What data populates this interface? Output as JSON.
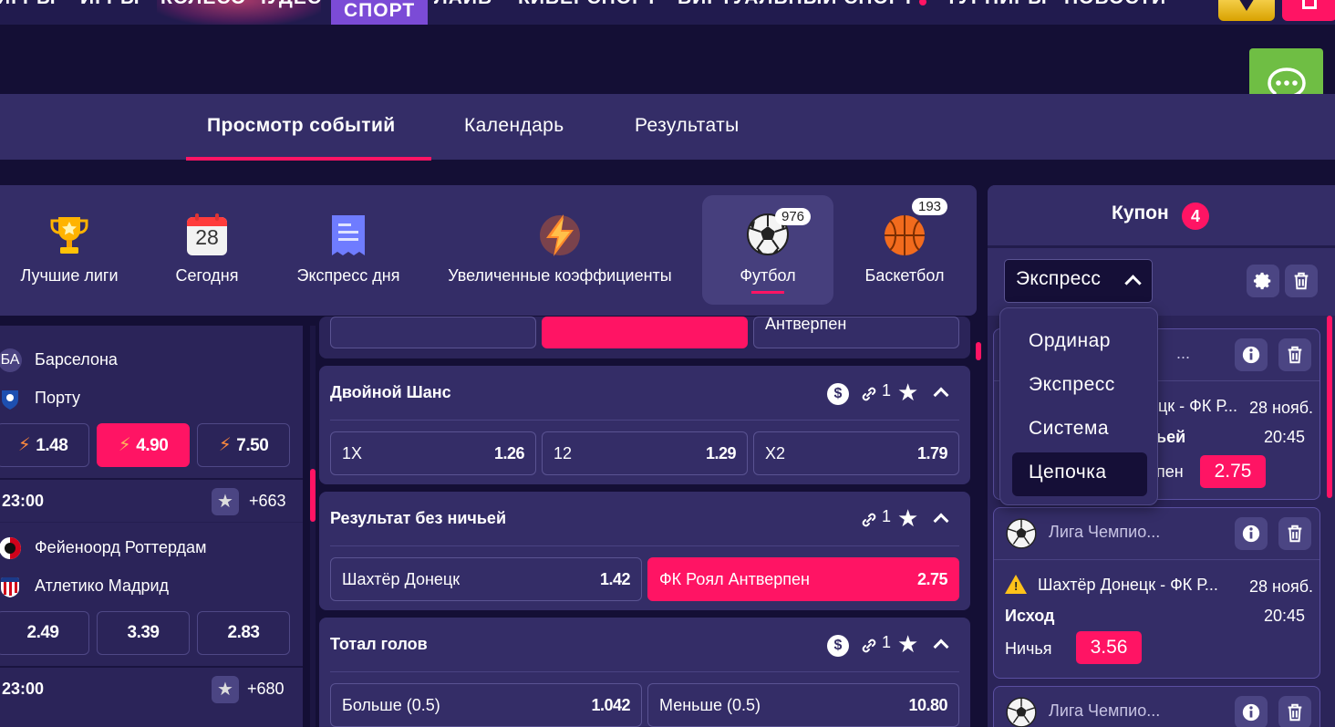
{
  "topnav": {
    "items": [
      {
        "label": "ИГРЫ",
        "active": false
      },
      {
        "label": "ИГРЫ",
        "active": false
      },
      {
        "label": "КОЛЕСО ЧУДЕС",
        "active": false
      },
      {
        "label": "СПОРТ",
        "active": true
      },
      {
        "label": "ЛАЙВ",
        "active": false
      },
      {
        "label": "КИБЕРСПОРТ",
        "active": false
      },
      {
        "label": "ВИРТУАЛЬНЫЙ СПОРТ",
        "active": false
      },
      {
        "label": "ТУРНИРЫ",
        "active": false
      },
      {
        "label": "НОВОСТИ",
        "active": false
      }
    ]
  },
  "tabs": [
    {
      "label": "Просмотр событий",
      "active": true
    },
    {
      "label": "Календарь",
      "active": false
    },
    {
      "label": "Результаты",
      "active": false
    }
  ],
  "categories": [
    {
      "label": "Лучшие лиги",
      "icon": "trophy-icon"
    },
    {
      "label": "Сегодня",
      "icon": "calendar-icon",
      "day": "28"
    },
    {
      "label": "Экспресс дня",
      "icon": "receipt-icon"
    },
    {
      "label": "Увеличенные коэффициенты",
      "icon": "lightning-icon"
    },
    {
      "label": "Футбол",
      "icon": "football-icon",
      "count": "976",
      "selected": true
    },
    {
      "label": "Баскетбол",
      "icon": "basketball-icon",
      "count": "193"
    }
  ],
  "left_matches": {
    "m1": {
      "team1": "Барселона",
      "team1_abbr": "БА",
      "team2": "Порту",
      "odds": [
        "1.48",
        "4.90",
        "7.50"
      ]
    },
    "m2": {
      "time": "23:00",
      "more": "+663",
      "team1": "Фейеноорд Роттердам",
      "team2": "Атлетико Мадрид",
      "odds": [
        "2.49",
        "3.39",
        "2.83"
      ]
    },
    "m3": {
      "time": "23:00",
      "more": "+680"
    }
  },
  "markets": {
    "top_partial": {
      "right_label": "Антверпен"
    },
    "double_chance": {
      "title": "Двойной Шанс",
      "link_count": "1",
      "outcomes": [
        {
          "label": "1X",
          "odd": "1.26"
        },
        {
          "label": "12",
          "odd": "1.29"
        },
        {
          "label": "X2",
          "odd": "1.79"
        }
      ]
    },
    "no_draw": {
      "title": "Результат без ничьей",
      "link_count": "1",
      "outcomes": [
        {
          "label": "Шахтёр Донецк",
          "odd": "1.42"
        },
        {
          "label": "ФК Роял Антверпен",
          "odd": "2.75"
        }
      ]
    },
    "total": {
      "title": "Тотал голов",
      "link_count": "1",
      "outcomes": [
        {
          "label": "Больше (0.5)",
          "odd": "1.042"
        },
        {
          "label": "Меньше (0.5)",
          "odd": "10.80"
        }
      ]
    }
  },
  "coupon": {
    "title": "Купон",
    "count": "4",
    "bet_type": "Экспресс",
    "dropdown": [
      "Ординар",
      "Экспресс",
      "Система",
      "Цепочка"
    ],
    "cards": {
      "c1": {
        "league": "...",
        "match": "цк - ФК Р...",
        "date": "28 нояб.",
        "market": "ьей",
        "time": "20:45",
        "selection": "пен",
        "odd": "2.75"
      },
      "c2": {
        "league": "Лига Чемпио...",
        "match": "Шахтёр Донецк - ФК Р...",
        "date": "28 нояб.",
        "market": "Исход",
        "time": "20:45",
        "selection": "Ничья",
        "odd": "3.56"
      },
      "c3": {
        "league": "Лига Чемпио..."
      }
    }
  },
  "colors": {
    "accent": "#ff1464",
    "panel": "#342d67",
    "background": "#140f35",
    "chat": "#6fbe44"
  }
}
